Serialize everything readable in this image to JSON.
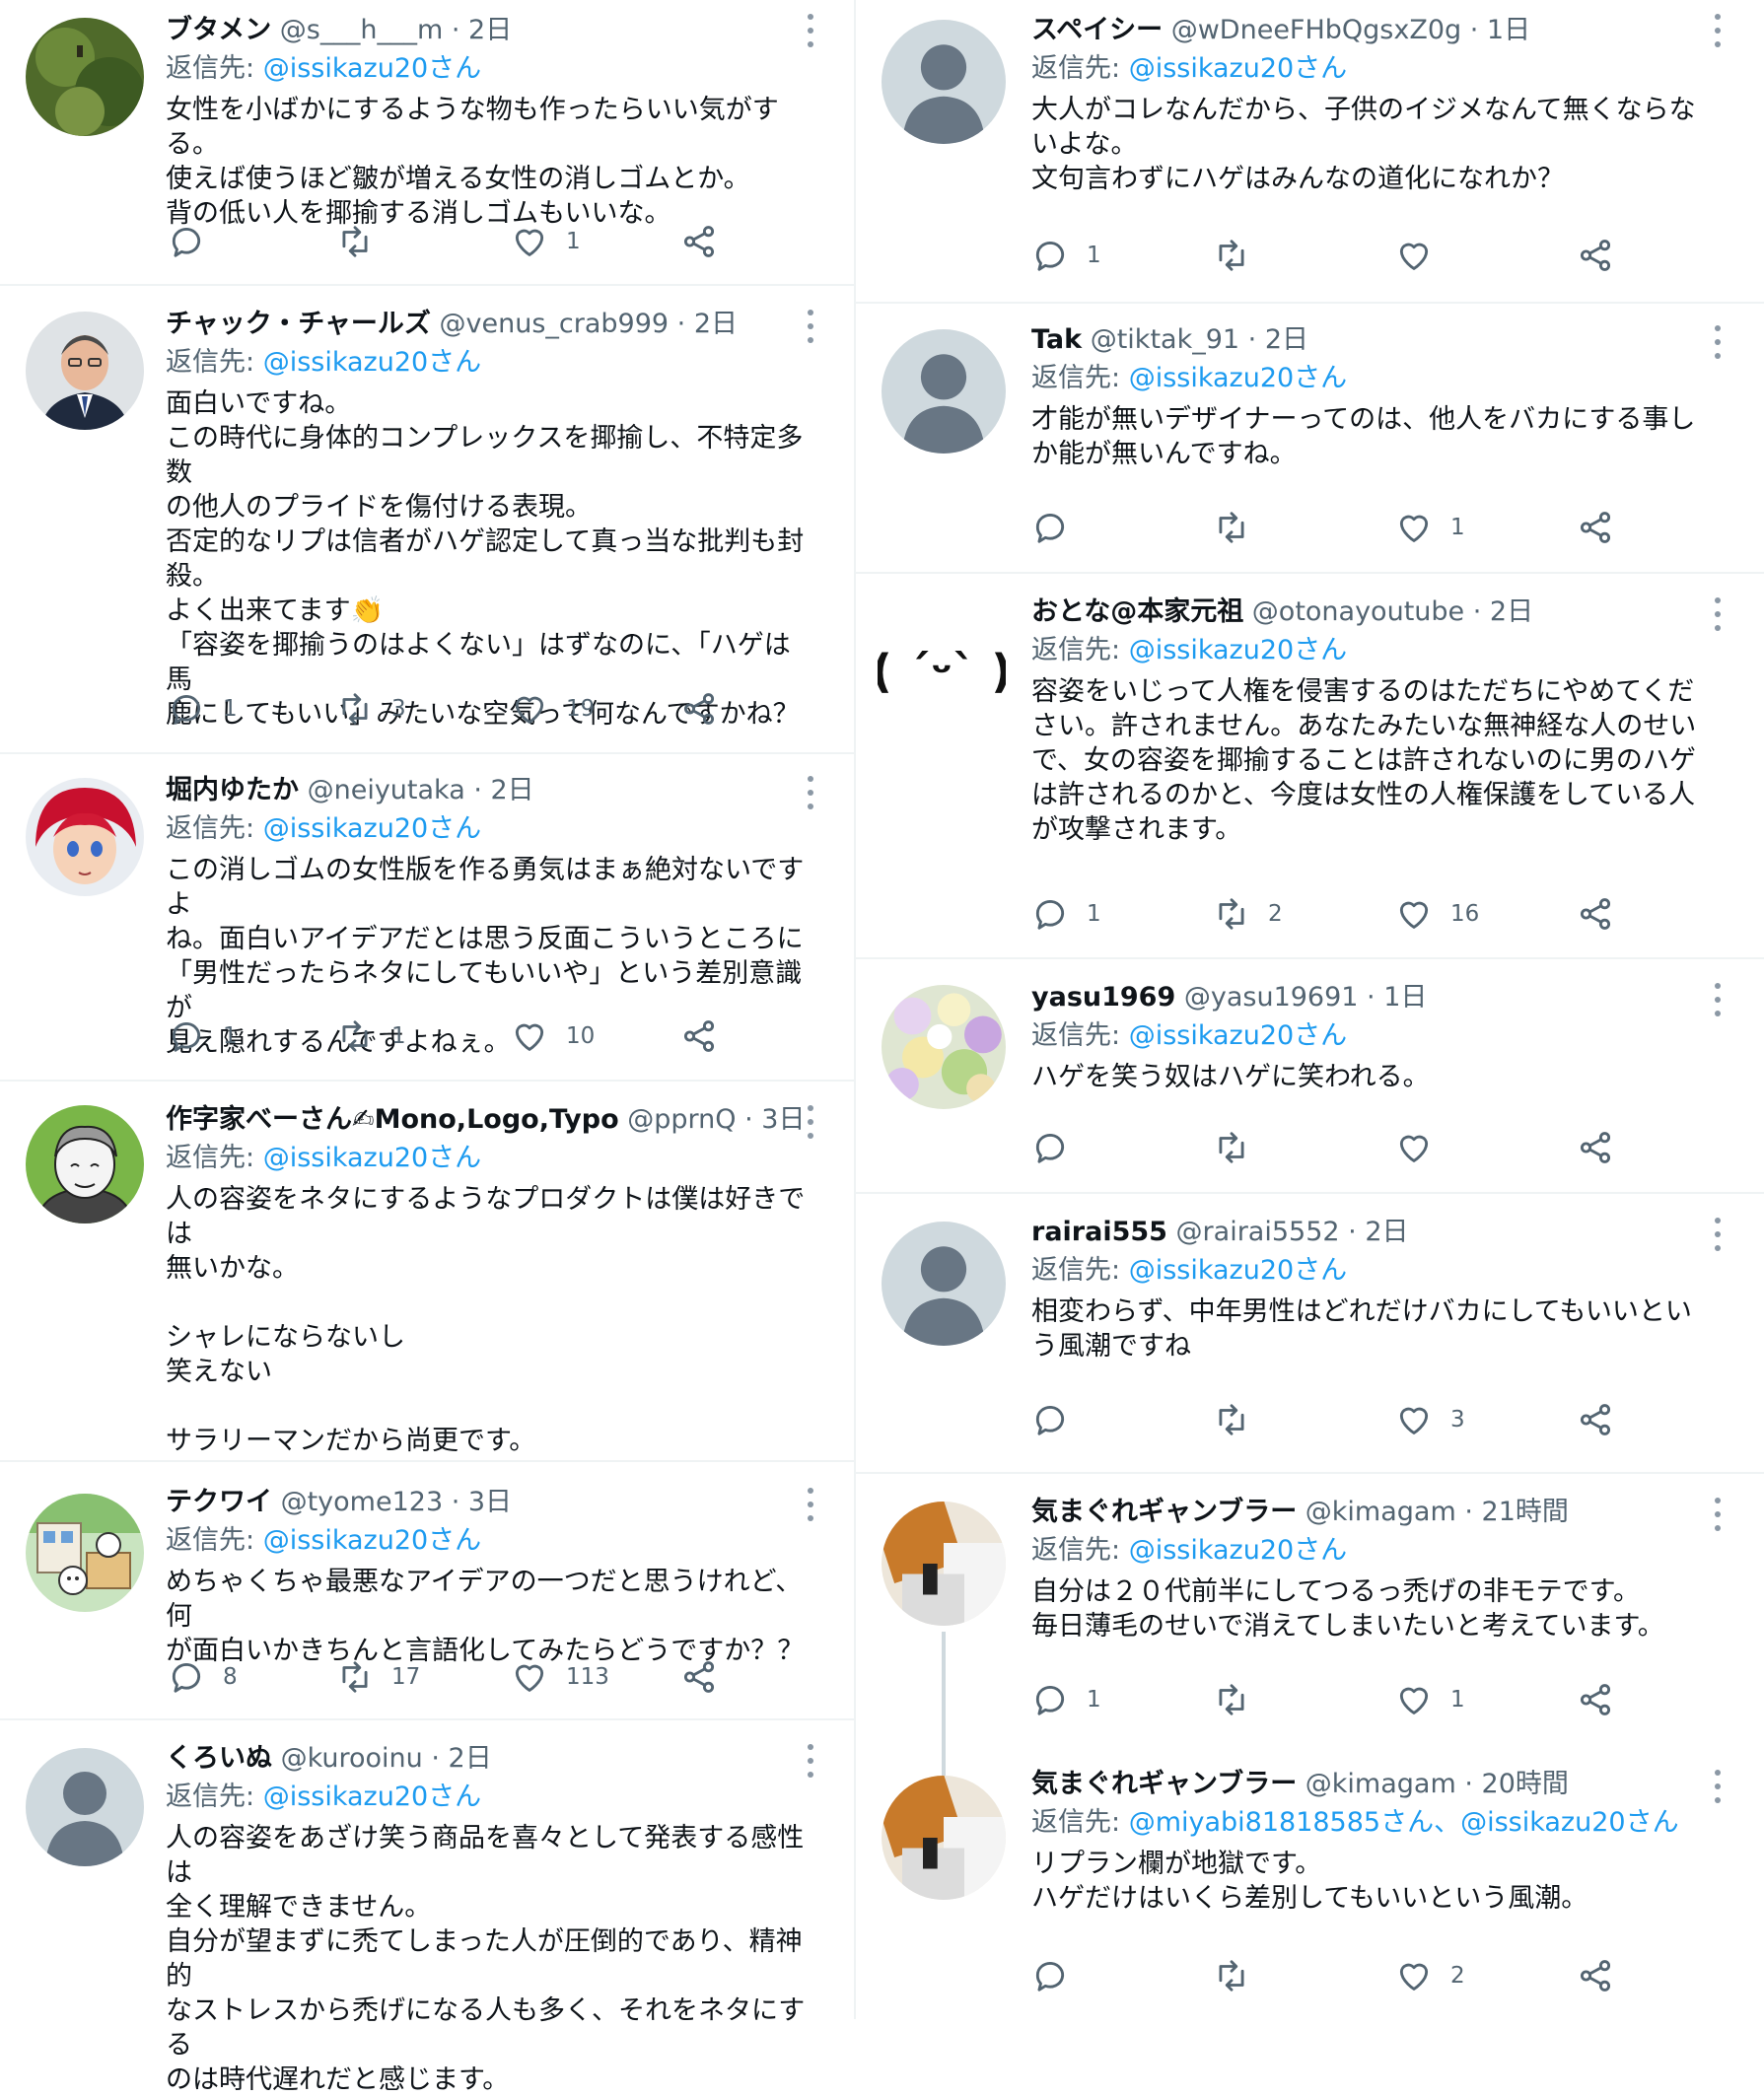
{
  "colors": {
    "accent": "#1d9bf0",
    "secondary_text": "#536471",
    "divider": "#eff3f4"
  },
  "icons": {
    "reply": "reply-icon",
    "retweet": "retweet-icon",
    "like": "heart-icon",
    "share": "share-icon",
    "more": "more-icon"
  },
  "left": {
    "tweets": [
      {
        "name": "ブタメン",
        "handle": "@s___h___m",
        "time": "2日",
        "reply_prefix": "返信先: ",
        "reply_to": "@issikazu20さん",
        "text": "女性を小ばかにするような物も作ったらいい気がする。\n使えば使うほど皺が増える女性の消しゴムとか。\n背の低い人を揶揄する消しゴムもいいな。",
        "replies": "",
        "retweets": "",
        "likes": "1"
      },
      {
        "name": "チャック・チャールズ",
        "handle": "@venus_crab999",
        "time": "2日",
        "reply_prefix": "返信先: ",
        "reply_to": "@issikazu20さん",
        "text": "面白いですね。\nこの時代に身体的コンプレックスを揶揄し、不特定多数\nの他人のプライドを傷付ける表現。\n否定的なリプは信者がハゲ認定して真っ当な批判も封\n殺。\nよく出来てます👏\n「容姿を揶揄うのはよくない」はずなのに、「ハゲは馬\n鹿にしてもいい」みたいな空気って何なんですかね？",
        "replies": "1",
        "retweets": "3",
        "likes": "19"
      },
      {
        "name": "堀内ゆたか",
        "handle": "@neiyutaka",
        "time": "2日",
        "reply_prefix": "返信先: ",
        "reply_to": "@issikazu20さん",
        "text": "この消しゴムの女性版を作る勇気はまぁ絶対ないですよ\nね。面白いアイデアだとは思う反面こういうところに\n「男性だったらネタにしてもいいや」という差別意識が\n見え隠れするんですよねぇ。",
        "replies": "1",
        "retweets": "1",
        "likes": "10"
      },
      {
        "name": "作字家べーさん✍Mono,Logo,Typo",
        "handle": "@pprnQ",
        "time": "3日",
        "reply_prefix": "返信先: ",
        "reply_to": "@issikazu20さん",
        "text": "人の容姿をネタにするようなプロダクトは僕は好きでは\n無いかな。\n\nシャレにならないし\n笑えない\n\nサラリーマンだから尚更です。",
        "replies": "",
        "retweets": "",
        "likes": ""
      },
      {
        "name": "テクワイ",
        "handle": "@tyome123",
        "time": "3日",
        "reply_prefix": "返信先: ",
        "reply_to": "@issikazu20さん",
        "text": "めちゃくちゃ最悪なアイデアの一つだと思うけれど、何\nが面白いかきちんと言語化してみたらどうですか？？",
        "replies": "8",
        "retweets": "17",
        "likes": "113"
      },
      {
        "name": "くろいぬ",
        "handle": "@kurooinu",
        "time": "2日",
        "reply_prefix": "返信先: ",
        "reply_to": "@issikazu20さん",
        "text": "人の容姿をあざけ笑う商品を喜々として発表する感性は\n全く理解できません。\n自分が望まずに禿てしまった人が圧倒的であり、精神的\nなストレスから禿げになる人も多く、それをネタにする\nのは時代遅れだと感じます。",
        "replies": "",
        "retweets": "",
        "likes": ""
      }
    ]
  },
  "right": {
    "tweets": [
      {
        "name": "スペイシー",
        "handle": "@wDneeFHbQgsxZ0g",
        "time": "1日",
        "reply_prefix": "返信先: ",
        "reply_to": "@issikazu20さん",
        "text": "大人がコレなんだから、子供のイジメなんて無くならな\nいよな。\n文句言わずにハゲはみんなの道化になれか？",
        "replies": "1",
        "retweets": "",
        "likes": ""
      },
      {
        "name": "Tak",
        "handle": "@tiktak_91",
        "time": "2日",
        "reply_prefix": "返信先: ",
        "reply_to": "@issikazu20さん",
        "text": "才能が無いデザイナーってのは、他人をバカにする事し\nか能が無いんですね。",
        "replies": "",
        "retweets": "",
        "likes": "1"
      },
      {
        "name": "おとな@本家元祖",
        "handle": "@otonayoutube",
        "time": "2日",
        "reply_prefix": "返信先: ",
        "reply_to": "@issikazu20さん",
        "avatar_text": "( ˊᵕˋ )",
        "text": "容姿をいじって人権を侵害するのはただちにやめてくだ\nさい。許されません。あなたみたいな無神経な人のせい\nで、女の容姿を揶揄することは許されないのに男のハゲ\nは許されるのかと、今度は女性の人権保護をしている人\nが攻撃されます。",
        "replies": "1",
        "retweets": "2",
        "likes": "16"
      },
      {
        "name": "yasu1969",
        "handle": "@yasu19691",
        "time": "1日",
        "reply_prefix": "返信先: ",
        "reply_to": "@issikazu20さん",
        "text": "ハゲを笑う奴はハゲに笑われる。",
        "replies": "",
        "retweets": "",
        "likes": ""
      },
      {
        "name": "rairai555",
        "handle": "@rairai5552",
        "time": "2日",
        "reply_prefix": "返信先: ",
        "reply_to": "@issikazu20さん",
        "text": "相変わらず、中年男性はどれだけバカにしてもいいとい\nう風潮ですね",
        "replies": "",
        "retweets": "",
        "likes": "3"
      },
      {
        "name": "気まぐれギャンブラー",
        "handle": "@kimagam",
        "time": "21時間",
        "reply_prefix": "返信先: ",
        "reply_to": "@issikazu20さん",
        "text": "自分は２０代前半にしてつるっ禿げの非モテです。\n毎日薄毛のせいで消えてしまいたいと考えています。",
        "replies": "1",
        "retweets": "",
        "likes": "1"
      },
      {
        "name": "気まぐれギャンブラー",
        "handle": "@kimagam",
        "time": "20時間",
        "reply_prefix": "返信先: ",
        "reply_to": "@miyabi81818585さん、@issikazu20さん",
        "text": "リプラン欄が地獄です。\nハゲだけはいくら差別してもいいという風潮。",
        "replies": "",
        "retweets": "",
        "likes": "2"
      }
    ]
  }
}
